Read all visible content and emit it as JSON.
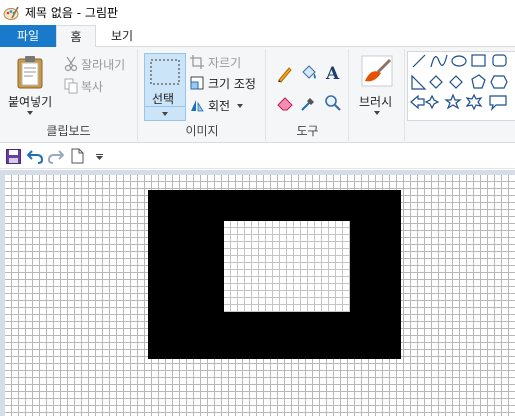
{
  "window": {
    "title": "제목 없음 - 그림판"
  },
  "tabs": [
    {
      "label": "파일"
    },
    {
      "label": "홈"
    },
    {
      "label": "보기"
    }
  ],
  "clipboard": {
    "paste_label": "붙여넣기",
    "cut_label": "잘라내기",
    "copy_label": "복사",
    "group_label": "클립보드"
  },
  "image": {
    "select_label": "선택",
    "crop_label": "자르기",
    "resize_label": "크기 조정",
    "rotate_label": "회전",
    "group_label": "이미지"
  },
  "tools": {
    "group_label": "도구",
    "text_tool_glyph": "A"
  },
  "brushes": {
    "label": "브러시"
  },
  "colors": {
    "accent": "#1979ca",
    "canvas_bg": "#d4dde8",
    "shape_fill": "#000000"
  }
}
